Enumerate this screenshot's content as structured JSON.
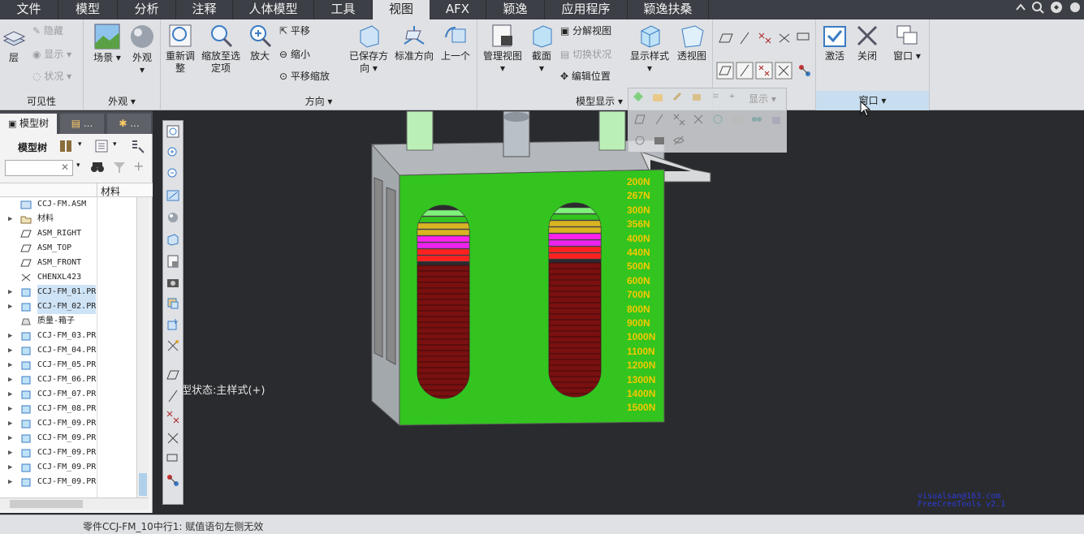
{
  "menubar": {
    "tabs": [
      "文件",
      "模型",
      "分析",
      "注释",
      "人体模型",
      "工具",
      "视图",
      "AFX",
      "颖逸",
      "应用程序",
      "颖逸扶桑"
    ],
    "active_index": 6
  },
  "ribbon": {
    "visibility": {
      "layer": "层",
      "hide": "隐藏",
      "show": "显示",
      "status": "状况",
      "group_label": "可见性"
    },
    "appearance": {
      "scene": "场景",
      "appearance": "外观",
      "group_label": "外观"
    },
    "orientation": {
      "refit": "重新调整",
      "zoom_to_selected": "缩放至选定项",
      "zoom_in": "放大",
      "pan": "平移",
      "zoom_out": "缩小",
      "pan_zoom": "平移缩放",
      "saved_orientations": "已保存方向",
      "standard_orientation": "标准方向",
      "previous": "上一个",
      "group_label": "方向"
    },
    "model_display": {
      "manage_views": "管理视图",
      "section": "截面",
      "explode_view": "分解视图",
      "toggle_status": "切换状况",
      "edit_position": "编辑位置",
      "display_style": "显示样式",
      "perspective": "透视图",
      "group_label": "模型显示"
    },
    "display": {
      "group_label": "显示"
    },
    "window": {
      "activate": "激活",
      "close": "关闭",
      "window": "窗口",
      "group_label": "窗口"
    }
  },
  "left_panel": {
    "tabs": [
      "模型树",
      "...",
      "..."
    ],
    "toolbar_label": "模型树",
    "column_header": "材料",
    "tree": [
      {
        "label": "CCJ-FM.ASM",
        "icon": "assembly-icon",
        "arrow": ""
      },
      {
        "label": "材料",
        "icon": "folder-icon",
        "arrow": "▶"
      },
      {
        "label": "ASM_RIGHT",
        "icon": "datum-plane-icon",
        "arrow": ""
      },
      {
        "label": "ASM_TOP",
        "icon": "datum-plane-icon",
        "arrow": ""
      },
      {
        "label": "ASM_FRONT",
        "icon": "datum-plane-icon",
        "arrow": ""
      },
      {
        "label": "CHENXL423",
        "icon": "coordinate-system-icon",
        "arrow": ""
      },
      {
        "label": "CCJ-FM_01.PR",
        "icon": "part-icon",
        "arrow": "▶",
        "selected": true
      },
      {
        "label": "CCJ-FM_02.PR",
        "icon": "part-icon",
        "arrow": "▶",
        "selected": true
      },
      {
        "label": "质量-箱子",
        "icon": "mass-icon",
        "arrow": ""
      },
      {
        "label": "CCJ-FM_03.PR",
        "icon": "part-icon",
        "arrow": "▶"
      },
      {
        "label": "CCJ-FM_04.PR",
        "icon": "part-icon",
        "arrow": "▶"
      },
      {
        "label": "CCJ-FM_05.PR",
        "icon": "part-icon",
        "arrow": "▶"
      },
      {
        "label": "CCJ-FM_06.PR",
        "icon": "part-icon",
        "arrow": "▶"
      },
      {
        "label": "CCJ-FM_07.PR",
        "icon": "part-icon",
        "arrow": "▶"
      },
      {
        "label": "CCJ-FM_08.PR",
        "icon": "part-icon",
        "arrow": "▶"
      },
      {
        "label": "CCJ-FM_09.PR",
        "icon": "part-icon",
        "arrow": "▶"
      },
      {
        "label": "CCJ-FM_09.PR",
        "icon": "part-icon",
        "arrow": "▶"
      },
      {
        "label": "CCJ-FM_09.PR",
        "icon": "part-icon",
        "arrow": "▶"
      },
      {
        "label": "CCJ-FM_09.PR",
        "icon": "part-icon",
        "arrow": "▶"
      },
      {
        "label": "CCJ-FM_09.PR",
        "icon": "part-icon",
        "arrow": "▶"
      }
    ]
  },
  "viewport": {
    "overlay_status": "型状态:主样式(+)",
    "force_labels": [
      "200N",
      "267N",
      "300N",
      "356N",
      "400N",
      "440N",
      "500N",
      "600N",
      "700N",
      "800N",
      "900N",
      "1000N",
      "1100N",
      "1200N",
      "1300N",
      "1400N",
      "1500N"
    ],
    "watermark_line1": "visualsan@163.com",
    "watermark_line2": "FreeCreoTools v2.1"
  },
  "status": {
    "message": "零件CCJ-FM_10中行1: 赋值语句左侧无效"
  },
  "colors": {
    "menubar": "#3c3f45",
    "ribbon": "#dfe1e4",
    "viewport": "#2a2b2e",
    "front_panel": "#33c41f",
    "force_label": "#f5c800",
    "watermark": "#2c3cd8"
  }
}
